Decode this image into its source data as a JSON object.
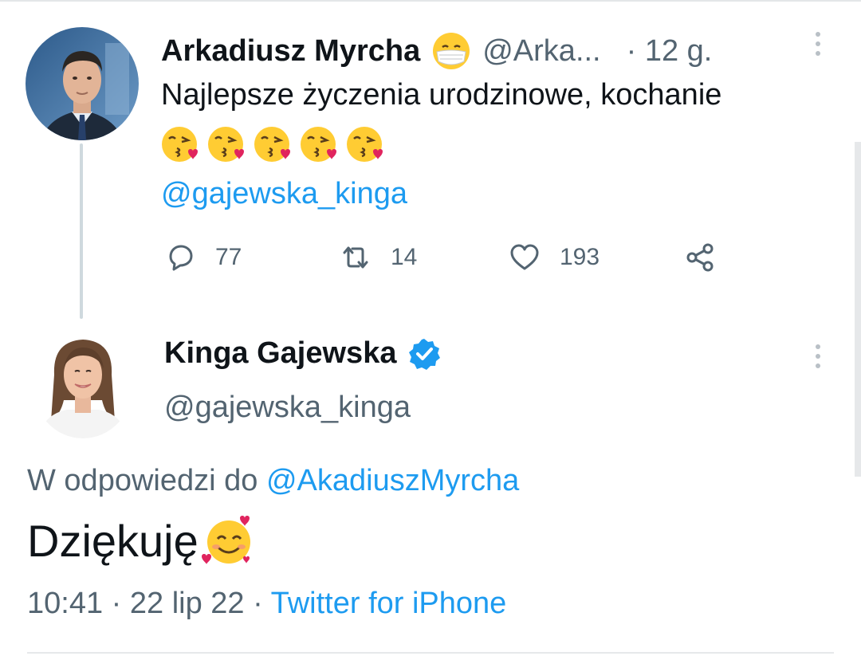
{
  "tweet1": {
    "author_name": "Arkadiusz Myrcha",
    "author_handle": "@Arka...",
    "time_ago": "· 12 g.",
    "text": "Najlepsze życzenia urodzinowe, kochanie",
    "mention": "@gajewska_kinga",
    "replies": "77",
    "retweets": "14",
    "likes": "193"
  },
  "tweet2": {
    "author_name": "Kinga Gajewska",
    "author_handle": "@gajewska_kinga",
    "reply_prefix": "W odpowiedzi do ",
    "reply_to": "@AkadiuszMyrcha",
    "text": "Dziękuję",
    "timestamp": "10:41 · 22 lip 22 · ",
    "source": "Twitter for iPhone"
  },
  "colors": {
    "link": "#1d9bf0",
    "secondary_text": "#536471",
    "primary_text": "#0f1419"
  },
  "icons": [
    "face-with-mask-icon",
    "kissing-heart-icon",
    "reply-icon",
    "retweet-icon",
    "like-icon",
    "share-icon",
    "verified-badge-icon",
    "smiling-hearts-icon",
    "more-options-icon"
  ]
}
